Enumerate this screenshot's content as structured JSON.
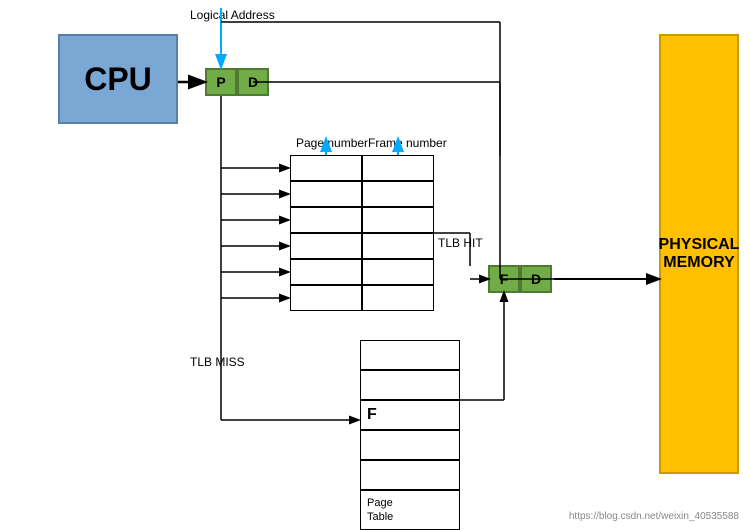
{
  "cpu": {
    "label": "CPU",
    "box_color": "#7BA7D4"
  },
  "physMem": {
    "line1": "PHYSICAL",
    "line2": "MEMORY",
    "box_color": "#FFC000"
  },
  "pd": {
    "p_label": "P",
    "d_label": "D"
  },
  "fd": {
    "f_label": "F",
    "d_label": "D"
  },
  "labels": {
    "logical_address": "Logical Address",
    "page_number": "Page number",
    "frame_number": "Frame number",
    "tlb_hit": "TLB HIT",
    "tlb_miss": "TLB MISS",
    "page_table": "Page\nTable",
    "f_in_table": "F"
  },
  "watermark": "https://blog.csdn.net/weixin_40535588"
}
